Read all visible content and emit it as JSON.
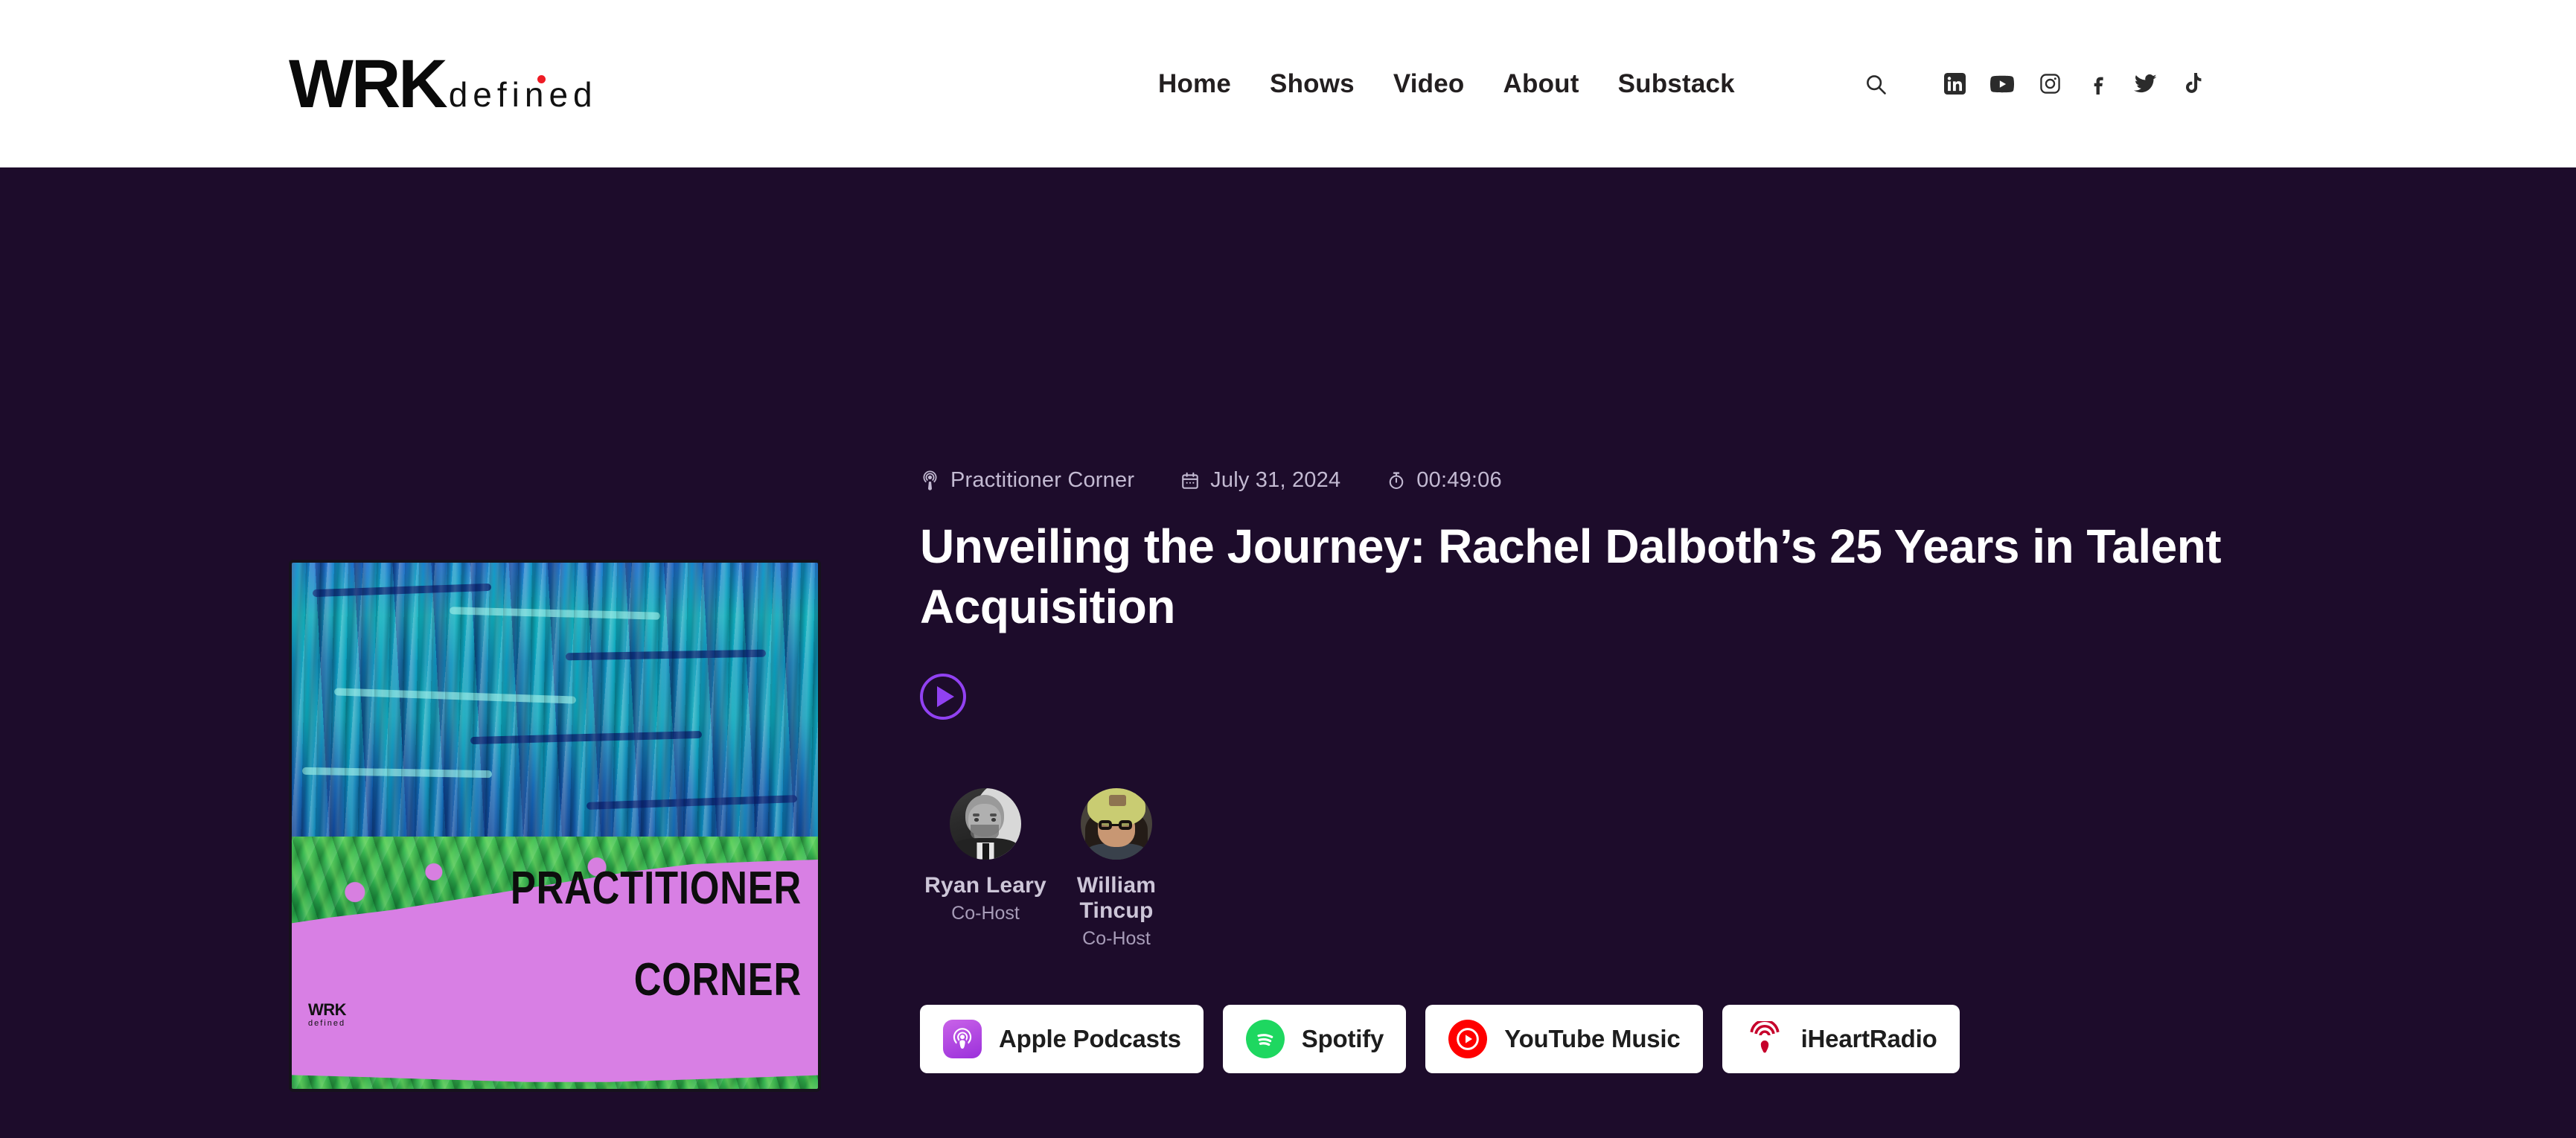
{
  "header": {
    "logo": {
      "primary": "WRK",
      "secondary": "defined"
    },
    "nav": [
      {
        "label": "Home"
      },
      {
        "label": "Shows"
      },
      {
        "label": "Video"
      },
      {
        "label": "About"
      },
      {
        "label": "Substack"
      }
    ],
    "icons": [
      {
        "name": "search-icon"
      },
      {
        "name": "linkedin-icon"
      },
      {
        "name": "youtube-icon"
      },
      {
        "name": "instagram-icon"
      },
      {
        "name": "facebook-icon"
      },
      {
        "name": "twitter-icon"
      },
      {
        "name": "tiktok-icon"
      }
    ]
  },
  "episode": {
    "show": "Practitioner Corner",
    "date": "July 31, 2024",
    "duration": "00:49:06",
    "title": "Unveiling the Journey: Rachel Dalboth’s 25 Years in Talent Acquisition",
    "play_label": "Play"
  },
  "cover": {
    "line1": "PRACTITIONER",
    "line2": "CORNER",
    "logo_primary": "WRK",
    "logo_secondary": "defined"
  },
  "hosts": [
    {
      "name": "Ryan Leary",
      "role": "Co-Host"
    },
    {
      "name": "William Tincup",
      "role": "Co-Host"
    }
  ],
  "platforms": [
    {
      "label": "Apple Podcasts",
      "icon": "apple-podcasts-icon"
    },
    {
      "label": "Spotify",
      "icon": "spotify-icon"
    },
    {
      "label": "YouTube Music",
      "icon": "youtube-music-icon"
    },
    {
      "label": "iHeartRadio",
      "icon": "iheartradio-icon"
    }
  ],
  "colors": {
    "background": "#1d0c2b",
    "header_bg": "#ffffff",
    "accent_purple": "#9141f2",
    "meta_text": "#c3bad2",
    "logo_dot": "#ee1b24"
  }
}
